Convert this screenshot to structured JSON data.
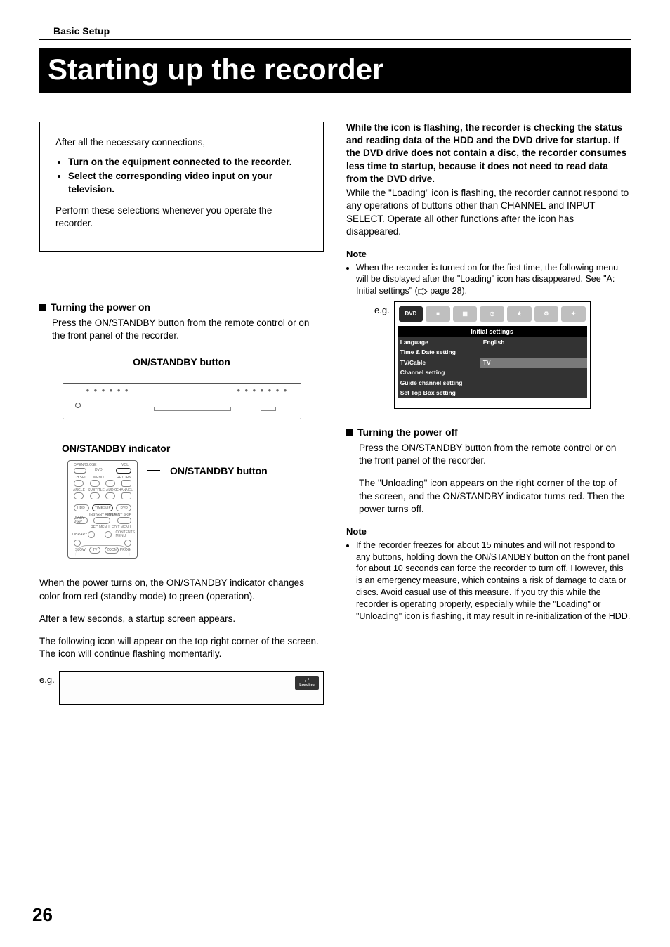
{
  "breadcrumb": "Basic Setup",
  "title": "Starting up the recorder",
  "intro": {
    "lead": "After all the necessary connections,",
    "bullets": [
      "Turn on the equipment connected to the recorder.",
      "Select the corresponding video input on your television."
    ],
    "tail": "Perform these selections whenever you operate the recorder."
  },
  "left": {
    "power_on_heading": "Turning the power on",
    "power_on_body": "Press the ON/STANDBY button from the remote control or on the front panel of the recorder.",
    "btn_label": "ON/STANDBY button",
    "ind_label": "ON/STANDBY indicator",
    "remote_btn_label": "ON/STANDBY button",
    "indicator_para": "When the power turns on, the ON/STANDBY indicator changes color from red (standby mode) to green (operation).",
    "startup_para": "After a few seconds, a startup screen appears.",
    "icon_para": "The following icon will appear on the top right corner of the screen. The icon will continue flashing momentarily.",
    "eg_label": "e.g.",
    "loading_label": "Loading"
  },
  "right": {
    "flash_bold": "While the icon is flashing, the recorder is checking the status and reading data of the HDD and the DVD drive for startup. If the DVD drive does not contain a disc, the recorder consumes less time to startup, because it does not need to read data from the DVD drive.",
    "flash_body": "While the \"Loading\" icon is flashing, the recorder cannot respond to any operations of buttons other than CHANNEL and INPUT SELECT. Operate all other functions after the icon has disappeared.",
    "note_h": "Note",
    "note1_a": "When the recorder is turned on for the first time, the following menu will be displayed after the \"Loading\" icon has disappeared. See \"A: Initial settings\" (",
    "note1_b": " page 28).",
    "eg_label": "e.g.",
    "menu": {
      "title": "Initial settings",
      "rows": [
        {
          "l": "Language",
          "r": "English",
          "style": "dark"
        },
        {
          "l": "Time & Date setting",
          "r": "",
          "style": "dark"
        },
        {
          "l": "TV/Cable",
          "r": "TV",
          "style": "hl"
        },
        {
          "l": "Channel setting",
          "r": "",
          "style": "dark"
        },
        {
          "l": "Guide channel setting",
          "r": "",
          "style": "dark"
        },
        {
          "l": "Set Top Box setting",
          "r": "",
          "style": "dark"
        }
      ]
    },
    "power_off_heading": "Turning the power off",
    "power_off_body": "Press the ON/STANDBY button from the remote control or on the front panel of the recorder.",
    "unloading_para": "The \"Unloading\" icon appears on the right corner of the top of the screen, and the ON/STANDBY indicator turns red. Then the power turns off.",
    "note2_h": "Note",
    "note2": "If the recorder freezes for about 15 minutes and will not respond to any buttons, holding down the ON/STANDBY button on the front panel for about 10 seconds can force the recorder to turn off. However, this is an emergency measure, which contains a risk of damage to data or discs. Avoid casual use of this measure. If you try this while the recorder is operating properly, especially while the \"Loading\" or \"Unloading\" icon is flashing, it may result in re-initialization of the HDD."
  },
  "remote_labels": {
    "open": "OPEN/CLOSE",
    "dvd": "DVD",
    "vol": "VOL",
    "chsel": "CH SEL",
    "menu": "MENU",
    "return": "RETURN",
    "angle": "ANGLE",
    "subtitle": "SUBTITLE",
    "audio": "AUDIO",
    "channel": "CHANNEL",
    "hdd": "HDD",
    "timeslip": "TIMESLIP",
    "dvd2": "DVD",
    "instl": "INSTANT REPLAY",
    "instr": "INSTANT SKIP",
    "easy": "EASY NAV",
    "recmenu": "REC MENU",
    "editmenu": "EDIT MENU",
    "library": "LIBRARY",
    "contents": "CONTENTS MENU",
    "slow": "SLOW",
    "tv": "TV",
    "zoom": "ZOOM",
    "prog": "PROG."
  },
  "page_number": "26"
}
